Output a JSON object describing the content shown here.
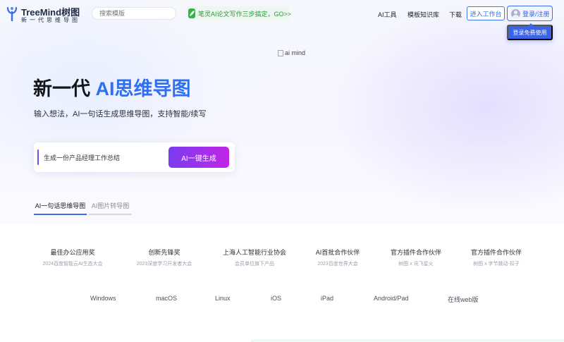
{
  "header": {
    "logo_name": "TreeMind树图",
    "logo_slogan": "新一代思维导图",
    "search_placeholder": "搜索模版",
    "promo_text": "笔灵AI论文写作三步搞定，GO>>",
    "nav": [
      "AI工具",
      "模板知识库",
      "下载"
    ],
    "workspace_label": "进入工作台",
    "login_label": "登录/注册",
    "free_label": "登录免费使用"
  },
  "hero": {
    "image_alt": "ai mind",
    "headline_plain": "新一代 ",
    "headline_accent": "AI思维导图",
    "subline": "输入想法，AI一句话生成思维导图，支持智能/续写",
    "input_value": "生成一份产品经理工作总结",
    "generate_label": "AI一键生成",
    "tabs": [
      "AI一句话思维导图",
      "AI图片转导图"
    ]
  },
  "awards": [
    {
      "title": "最佳办公应用奖",
      "sub": "2024百度智能云AI生态大会"
    },
    {
      "title": "创新先锋奖",
      "sub": "2023深度学习开发者大会"
    },
    {
      "title": "上海人工智能行业协会",
      "sub": "会员单位旗下产品"
    },
    {
      "title": "AI首批合作伙伴",
      "sub": "2023百度世界大会"
    },
    {
      "title": "官方插件合作伙伴",
      "sub": "树图 x 讯飞星火"
    },
    {
      "title": "官方插件合作伙伴",
      "sub": "树图 x 字节跳动-扣子"
    }
  ],
  "platforms": [
    "Windows",
    "macOS",
    "Linux",
    "iOS",
    "iPad",
    "Android/Pad",
    "在线web版"
  ],
  "colors": {
    "accent": "#2f6ff0",
    "gradient_start": "#7a3cf0",
    "gradient_end": "#c125e6",
    "promo_green": "#35b24a"
  }
}
